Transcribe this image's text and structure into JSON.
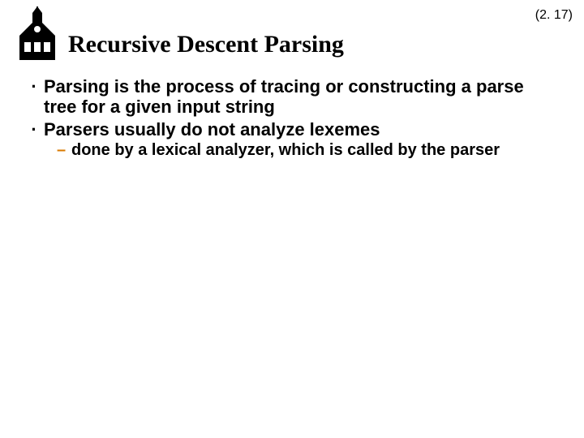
{
  "page_number": "(2. 17)",
  "title": "Recursive Descent Parsing",
  "bullets": [
    "Parsing is the process of tracing or constructing a parse tree for a given input string",
    "Parsers usually do not analyze lexemes"
  ],
  "sub": [
    "done by a lexical analyzer, which is called by the parser"
  ]
}
